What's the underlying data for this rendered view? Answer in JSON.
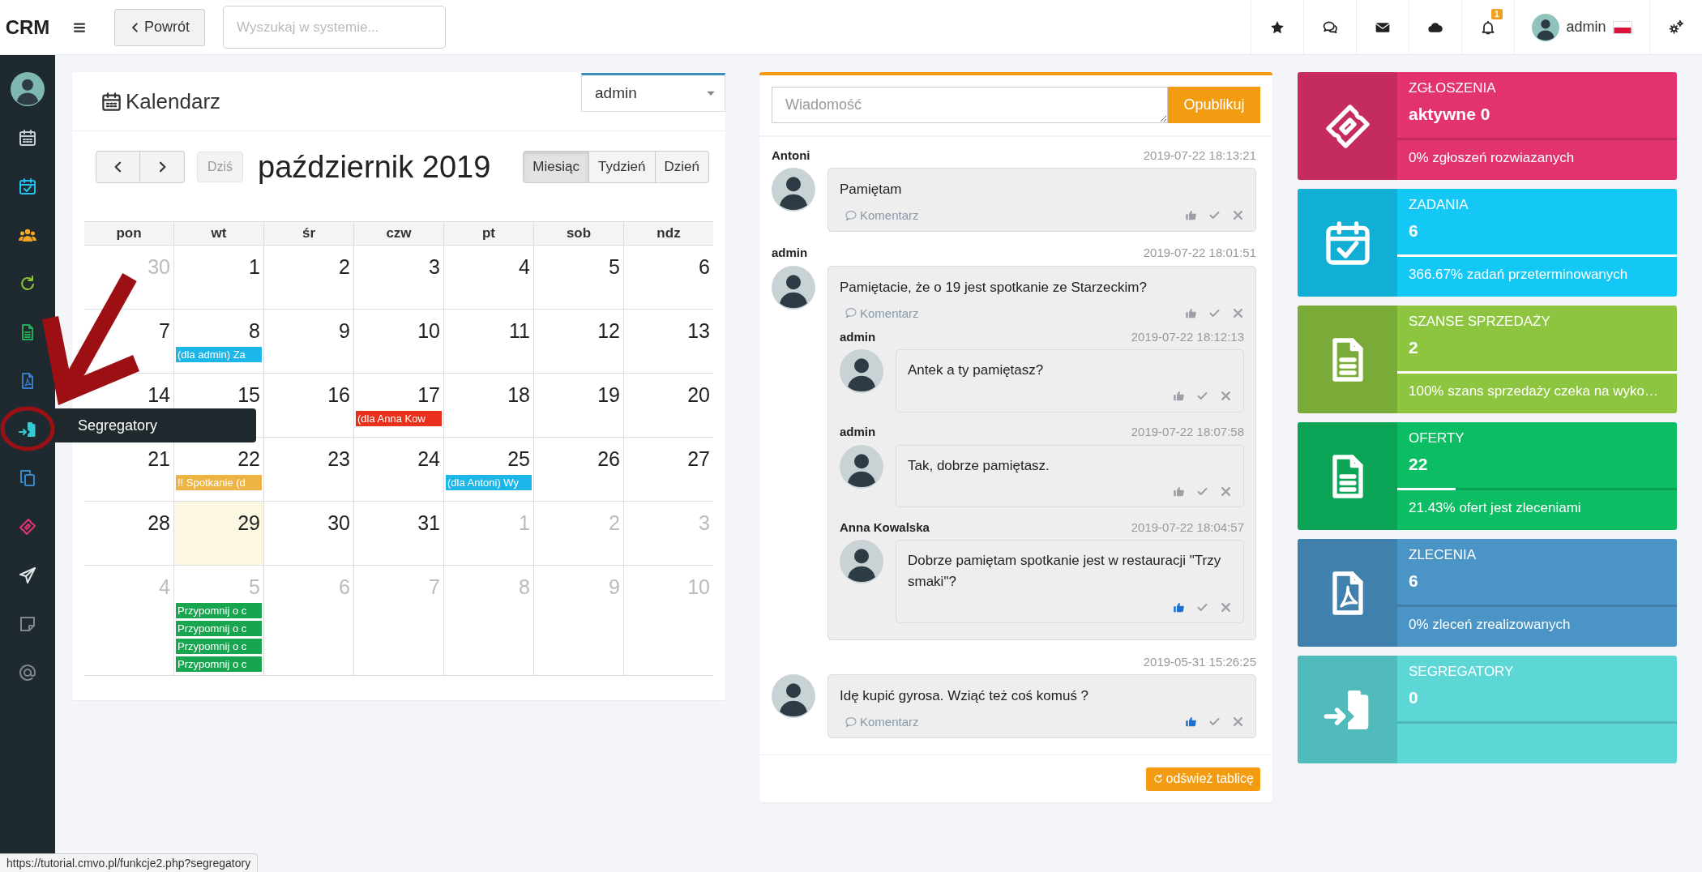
{
  "topbar": {
    "logo": "CRM",
    "back_button": "Powrót",
    "search": {
      "placeholder": "Wyszukaj w systemie..."
    },
    "icons": [
      {
        "kind": "star"
      },
      {
        "kind": "chat"
      },
      {
        "kind": "envelope"
      },
      {
        "kind": "cloud"
      },
      {
        "kind": "bell",
        "badge": "1"
      }
    ],
    "user": "admin"
  },
  "sidebar": {
    "items": [
      {
        "kind": "avatar",
        "color": "#7fb8b0"
      },
      {
        "kind": "calendar",
        "color": "#c9ced2"
      },
      {
        "kind": "calendar-check",
        "color": "#22c1ee"
      },
      {
        "kind": "users",
        "color": "#f5a623"
      },
      {
        "kind": "refresh",
        "color": "#8cc43c"
      },
      {
        "kind": "document",
        "color": "#1fae57"
      },
      {
        "kind": "pdf",
        "color": "#3a7cc9"
      },
      {
        "kind": "clipboard-in",
        "color": "#36c9cf",
        "tooltip": "Segregatory"
      },
      {
        "kind": "copy",
        "color": "#3a8acb"
      },
      {
        "kind": "ticket",
        "color": "#e2336f"
      },
      {
        "kind": "send",
        "color": "#e6e8ea"
      },
      {
        "kind": "note",
        "color": "#7c868c"
      },
      {
        "kind": "at",
        "color": "#7c868c"
      }
    ]
  },
  "calendar": {
    "title": "Kalendarz",
    "user_select": "admin",
    "today_button": "Dziś",
    "month_title": "październik 2019",
    "views": [
      {
        "label": "Miesiąc",
        "selected": true
      },
      {
        "label": "Tydzień",
        "selected": false
      },
      {
        "label": "Dzień",
        "selected": false
      }
    ],
    "weekdays": [
      "pon",
      "wt",
      "śr",
      "czw",
      "pt",
      "sob",
      "ndz"
    ],
    "weeks": [
      [
        {
          "day": "30",
          "other_month": true,
          "today": false
        },
        {
          "day": "1",
          "other_month": false,
          "today": false
        },
        {
          "day": "2",
          "other_month": false,
          "today": false
        },
        {
          "day": "3",
          "other_month": false,
          "today": false
        },
        {
          "day": "4",
          "other_month": false,
          "today": false
        },
        {
          "day": "5",
          "other_month": false,
          "today": false
        },
        {
          "day": "6",
          "other_month": false,
          "today": false
        }
      ],
      [
        {
          "day": "7",
          "other_month": false,
          "today": false
        },
        {
          "day": "8",
          "other_month": false,
          "today": false,
          "events": [
            {
              "text": "(dla admin) Za",
              "color": "#1cb6e8"
            }
          ]
        },
        {
          "day": "9",
          "other_month": false,
          "today": false
        },
        {
          "day": "10",
          "other_month": false,
          "today": false
        },
        {
          "day": "11",
          "other_month": false,
          "today": false
        },
        {
          "day": "12",
          "other_month": false,
          "today": false
        },
        {
          "day": "13",
          "other_month": false,
          "today": false
        }
      ],
      [
        {
          "day": "14",
          "other_month": false,
          "today": false
        },
        {
          "day": "15",
          "other_month": false,
          "today": false
        },
        {
          "day": "16",
          "other_month": false,
          "today": false
        },
        {
          "day": "17",
          "other_month": false,
          "today": false,
          "events": [
            {
              "text": "(dla Anna Kow",
              "color": "#e8301c"
            }
          ]
        },
        {
          "day": "18",
          "other_month": false,
          "today": false
        },
        {
          "day": "19",
          "other_month": false,
          "today": false
        },
        {
          "day": "20",
          "other_month": false,
          "today": false
        }
      ],
      [
        {
          "day": "21",
          "other_month": false,
          "today": false
        },
        {
          "day": "22",
          "other_month": false,
          "today": false,
          "events": [
            {
              "text": "!! Spotkanie (d",
              "color": "#edb443"
            }
          ]
        },
        {
          "day": "23",
          "other_month": false,
          "today": false
        },
        {
          "day": "24",
          "other_month": false,
          "today": false
        },
        {
          "day": "25",
          "other_month": false,
          "today": false,
          "events": [
            {
              "text": "(dla Antoni) Wy",
              "color": "#1cb6e8"
            }
          ]
        },
        {
          "day": "26",
          "other_month": false,
          "today": false
        },
        {
          "day": "27",
          "other_month": false,
          "today": false
        }
      ],
      [
        {
          "day": "28",
          "other_month": false,
          "today": false
        },
        {
          "day": "29",
          "other_month": false,
          "today": true
        },
        {
          "day": "30",
          "other_month": false,
          "today": false
        },
        {
          "day": "31",
          "other_month": false,
          "today": false
        },
        {
          "day": "1",
          "other_month": true,
          "today": false
        },
        {
          "day": "2",
          "other_month": true,
          "today": false
        },
        {
          "day": "3",
          "other_month": true,
          "today": false
        }
      ],
      [
        {
          "day": "4",
          "other_month": true,
          "today": false
        },
        {
          "day": "5",
          "other_month": true,
          "today": false,
          "events": [
            {
              "text": "Przypomnij o c",
              "color": "#17a550"
            },
            {
              "text": "Przypomnij o c",
              "color": "#17a550"
            },
            {
              "text": "Przypomnij o c",
              "color": "#17a550"
            },
            {
              "text": "Przypomnij o c",
              "color": "#17a550"
            }
          ]
        },
        {
          "day": "6",
          "other_month": true,
          "today": false
        },
        {
          "day": "7",
          "other_month": true,
          "today": false
        },
        {
          "day": "8",
          "other_month": true,
          "today": false
        },
        {
          "day": "9",
          "other_month": true,
          "today": false
        },
        {
          "day": "10",
          "other_month": true,
          "today": false
        }
      ]
    ]
  },
  "feed": {
    "message": {
      "placeholder": "Wiadomość"
    },
    "publish_button": "Opublikuj",
    "posts": [
      {
        "author": "Antoni",
        "time": "2019-07-22 18:13:21",
        "text": "Pamiętam",
        "comment_link": "Komentarz",
        "liked": false
      },
      {
        "author": "admin",
        "time": "2019-07-22 18:01:51",
        "text": "Pamiętacie, że o 19 jest spotkanie ze Starzeckim?",
        "comment_link": "Komentarz",
        "liked": false,
        "replies": [
          {
            "author": "admin",
            "time": "2019-07-22 18:12:13",
            "text": "Antek a ty pamiętasz?",
            "liked": false
          },
          {
            "author": "admin",
            "time": "2019-07-22 18:07:58",
            "text": "Tak, dobrze pamiętasz.",
            "liked": false
          },
          {
            "author": "Anna Kowalska",
            "time": "2019-07-22 18:04:57",
            "text": "Dobrze pamiętam spotkanie jest w restauracji \"Trzy smaki\"?",
            "liked": true
          }
        ]
      },
      {
        "time": "2019-05-31 15:26:25",
        "text": "Idę kupić gyrosa. Wziąć też coś komuś ?",
        "comment_link": "Komentarz",
        "liked": true
      }
    ],
    "refresh_button": "odśwież tablicę"
  },
  "stats": [
    {
      "kind": "ticket",
      "title": "ZGŁOSZENIA",
      "value": "aktywne 0",
      "level": 0,
      "subtitle": "0% zgłoszeń rozwiazanych",
      "color": "#e2336f"
    },
    {
      "kind": "calendar-check",
      "title": "ZADANIA",
      "value": "6",
      "level": 1,
      "subtitle": "366.67% zadań przeterminowanych",
      "color": "#14c8f6"
    },
    {
      "kind": "document",
      "title": "SZANSE SPRZEDAŻY",
      "value": "2",
      "level": 1,
      "subtitle": "100% szans sprzedaży czeka na wyko…",
      "color": "#8dc541"
    },
    {
      "kind": "document",
      "title": "OFERTY",
      "value": "22",
      "level": 0.21,
      "subtitle": "21.43% ofert jest zleceniami",
      "color": "#0dbd63"
    },
    {
      "kind": "pdf",
      "title": "ZLECENIA",
      "value": "6",
      "level": 0,
      "subtitle": "0% zleceń zrealizowanych",
      "color": "#4a94c6"
    },
    {
      "kind": "clipboard-in",
      "title": "SEGREGATORY",
      "value": "0",
      "level": 0,
      "color": "#5dd6d6"
    }
  ],
  "status_bar": "https://tutorial.cmvo.pl/funkcje2.php?segregatory"
}
